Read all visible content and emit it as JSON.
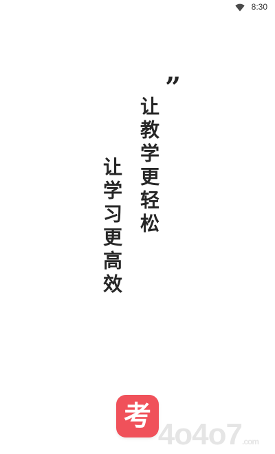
{
  "status_bar": {
    "time": "8:30",
    "wifi_icon": "wifi-icon"
  },
  "quote": {
    "mark": "”"
  },
  "slogan": {
    "line1": "让教学更轻松",
    "line2": "让学习更高效"
  },
  "logo": {
    "glyph": "考",
    "color": "#f0515a"
  },
  "watermark": {
    "text": "4o4o7",
    "suffix": ".com"
  }
}
